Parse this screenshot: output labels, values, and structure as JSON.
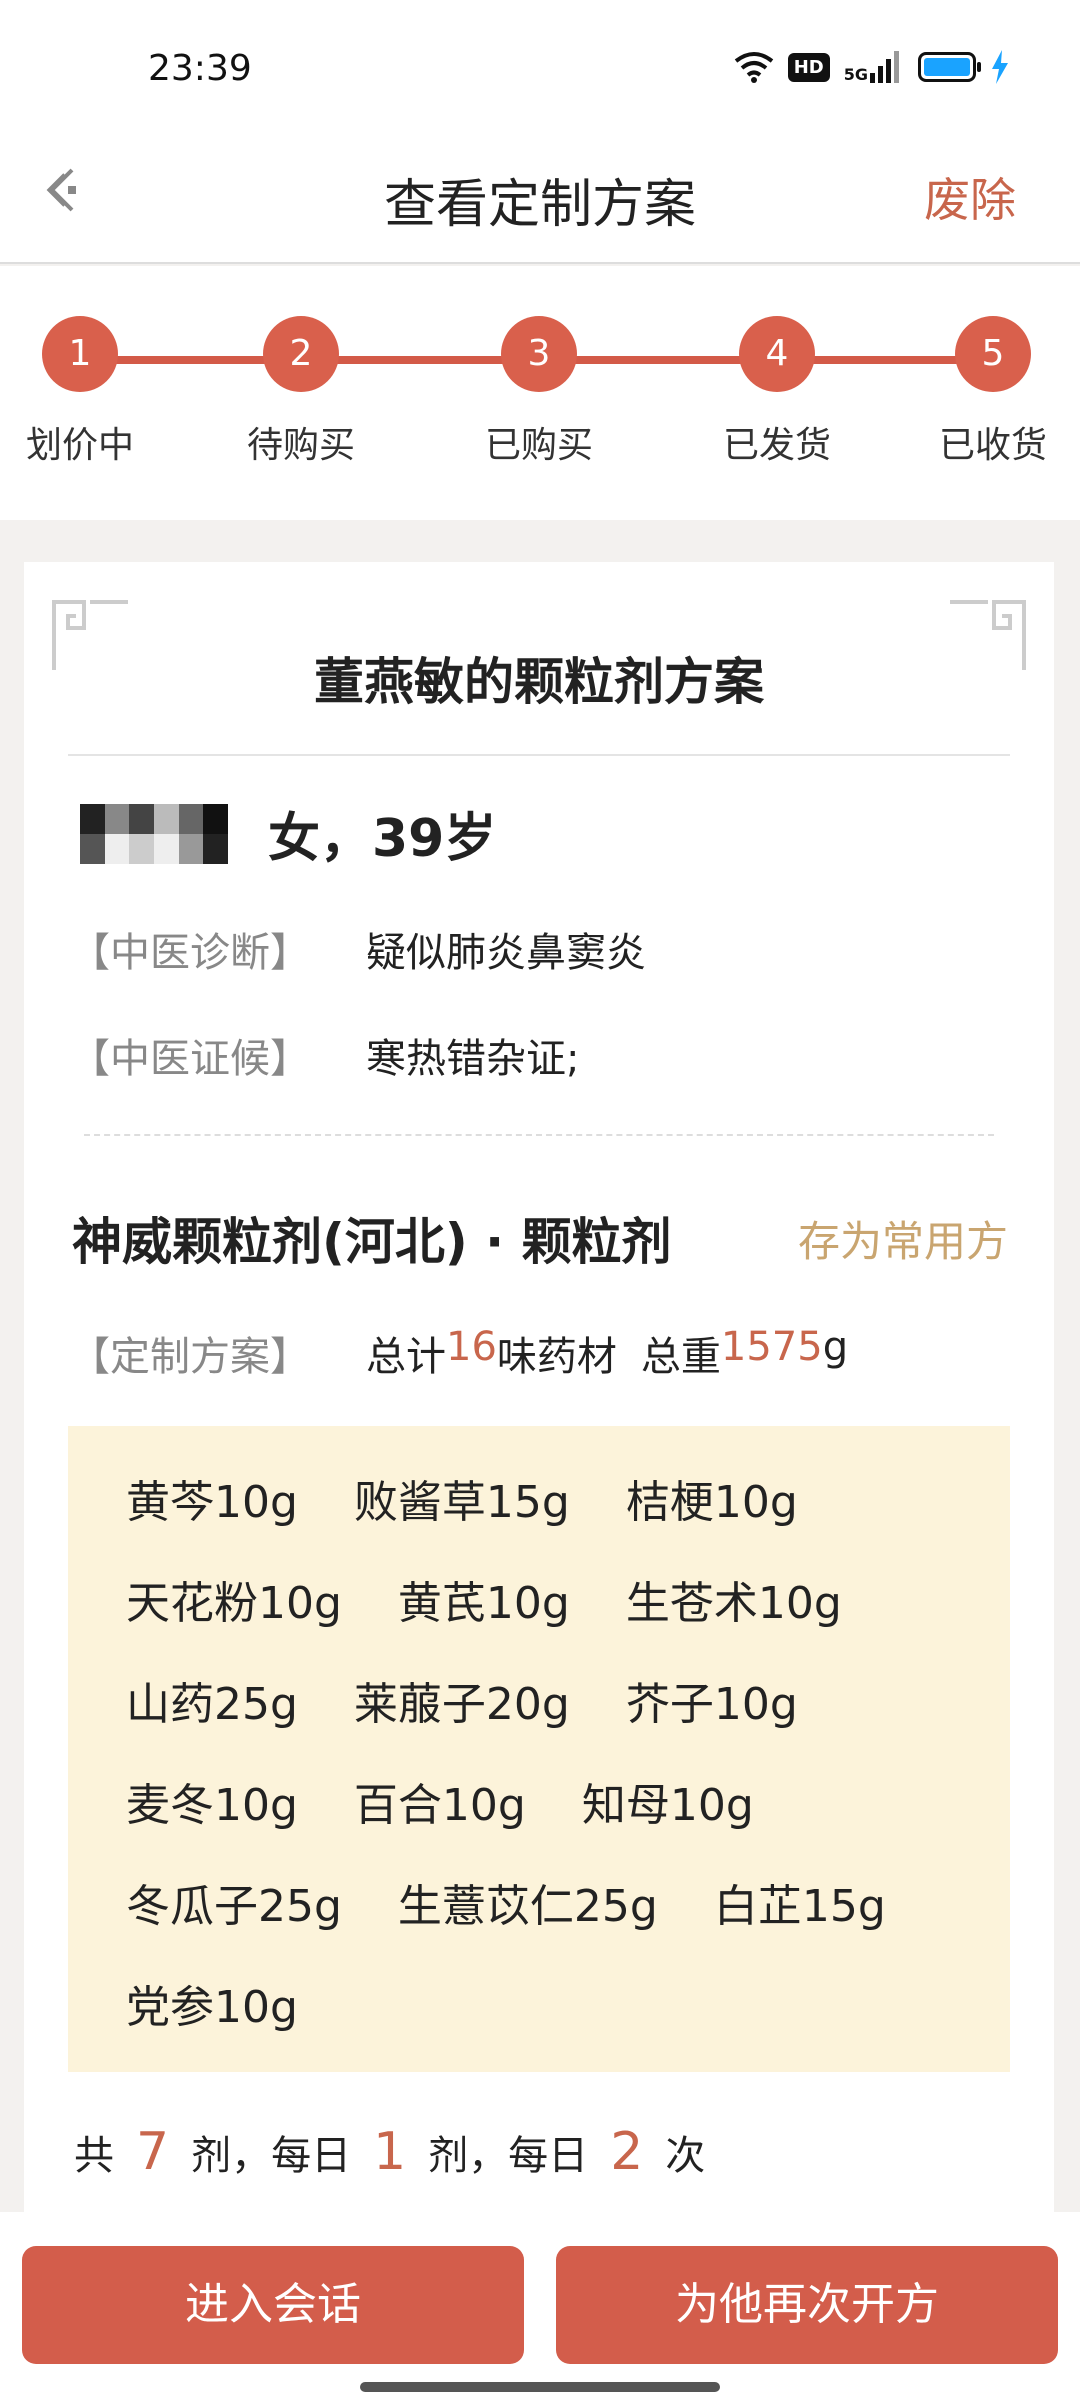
{
  "status": {
    "time": "23:39",
    "hd": "HD",
    "network": "5G"
  },
  "nav": {
    "title": "查看定制方案",
    "action": "废除"
  },
  "steps": [
    {
      "num": "1",
      "label": "划价中"
    },
    {
      "num": "2",
      "label": "待购买"
    },
    {
      "num": "3",
      "label": "已购买"
    },
    {
      "num": "4",
      "label": "已发货"
    },
    {
      "num": "5",
      "label": "已收货"
    }
  ],
  "plan": {
    "title": "董燕敏的颗粒剂方案"
  },
  "patient": {
    "gender_age": "女，39岁"
  },
  "diagnosis": {
    "label": "【中医诊断】",
    "value": "疑似肺炎鼻窦炎"
  },
  "syndrome": {
    "label": "【中医证候】",
    "value": "寒热错杂证;"
  },
  "product": {
    "name": "神威颗粒剂(河北) · 颗粒剂",
    "save_label": "存为常用方"
  },
  "summary": {
    "label": "【定制方案】",
    "total_prefix": "总计",
    "count": "16",
    "count_suffix": "味药材",
    "weight_prefix": "总重",
    "weight": "1575",
    "weight_unit": "g"
  },
  "herbs": [
    [
      "黄芩10g",
      "败酱草15g",
      "桔梗10g"
    ],
    [
      "天花粉10g",
      "黄芪10g",
      "生苍术10g"
    ],
    [
      "山药25g",
      "莱菔子20g",
      "芥子10g"
    ],
    [
      "麦冬10g",
      "百合10g",
      "知母10g"
    ],
    [
      "冬瓜子25g",
      "生薏苡仁25g",
      "白芷15g"
    ],
    [
      "党参10g"
    ]
  ],
  "dosage": {
    "p1": "共",
    "doses": "7",
    "p2": "剂，每日",
    "per_day": "1",
    "p3": "剂，每日",
    "times": "2",
    "p4": "次"
  },
  "buttons": {
    "chat": "进入会话",
    "represcribe": "为他再次开方"
  },
  "colors": {
    "accent": "#d35d4b",
    "highlight": "#c8664c",
    "gold": "#c9a570",
    "herb_bg": "#fcf3da"
  }
}
